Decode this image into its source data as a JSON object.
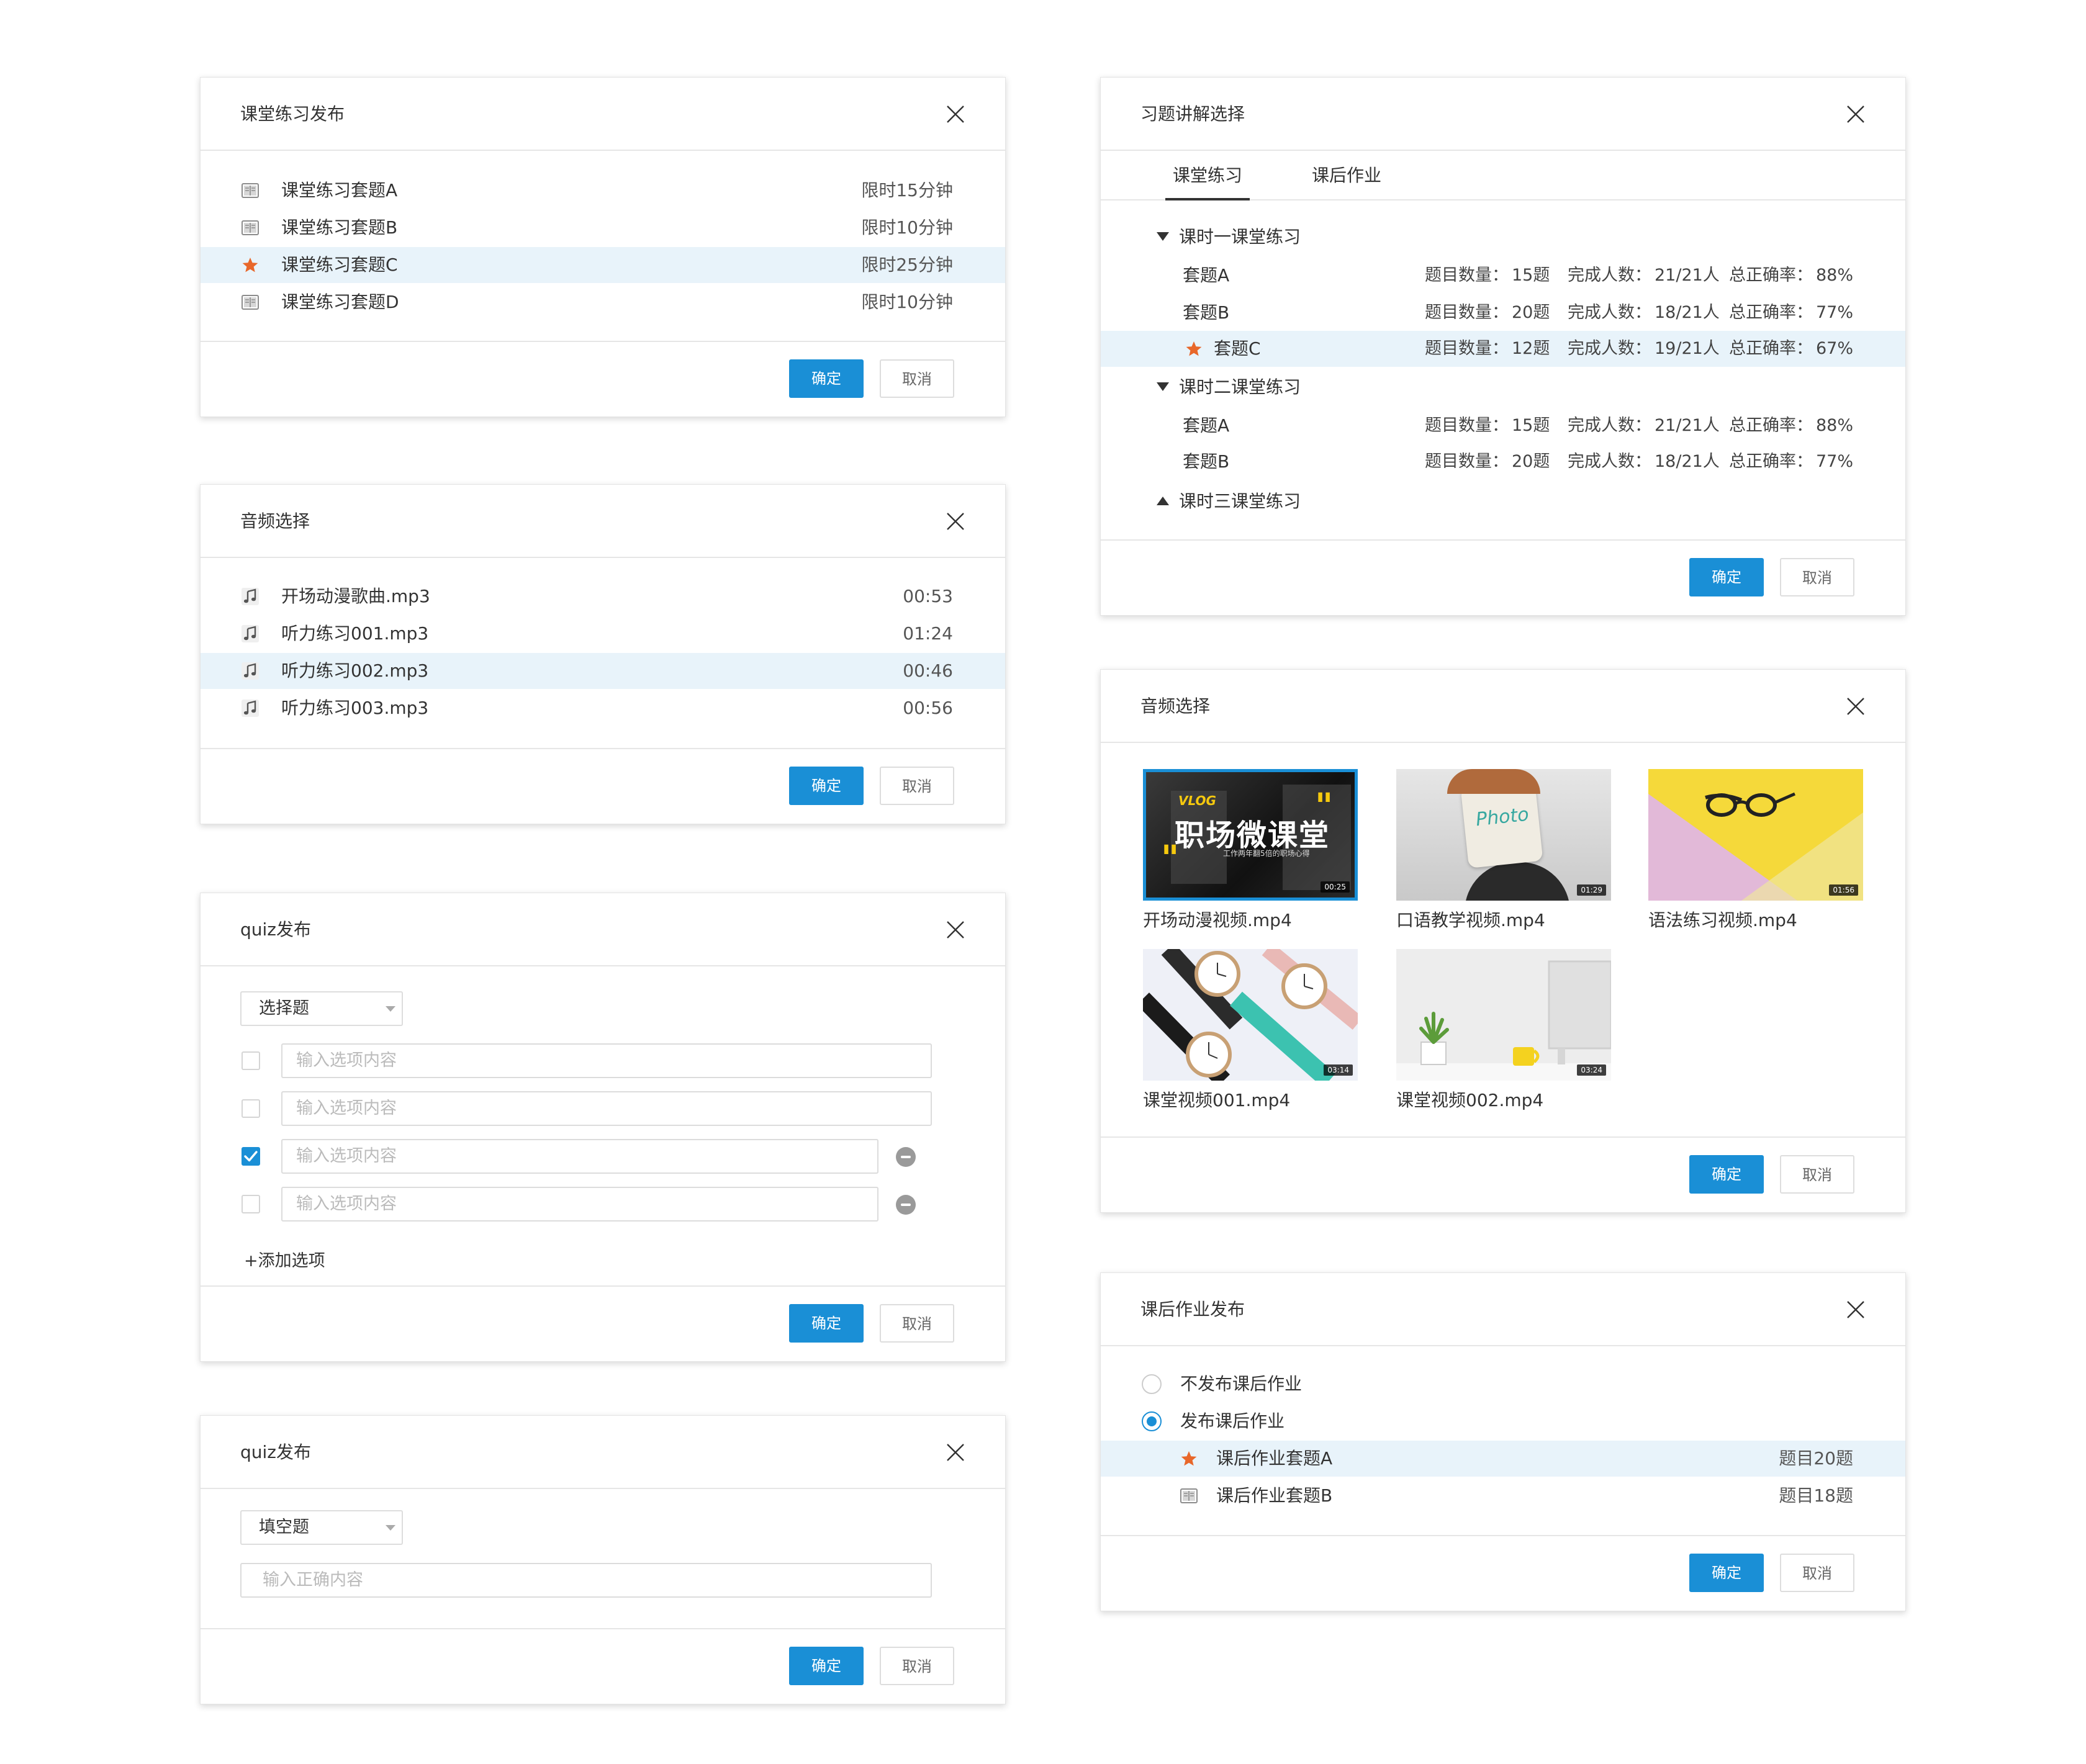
{
  "colors": {
    "accent": "#1a8fd6",
    "selected_row": "#e8f3fa",
    "star": "#e8672a"
  },
  "common": {
    "ok": "确定",
    "cancel": "取消"
  },
  "d1": {
    "title": "课堂练习发布",
    "items": [
      {
        "label": "课堂练习套题A",
        "time": "限时15分钟",
        "icon": "book-icon"
      },
      {
        "label": "课堂练习套题B",
        "time": "限时10分钟",
        "icon": "book-icon"
      },
      {
        "label": "课堂练习套题C",
        "time": "限时25分钟",
        "icon": "star-icon"
      },
      {
        "label": "课堂练习套题D",
        "time": "限时10分钟",
        "icon": "book-icon"
      }
    ]
  },
  "d2": {
    "title": "音频选择",
    "items": [
      {
        "label": "开场动漫歌曲.mp3",
        "time": "00:53",
        "icon": "music-icon"
      },
      {
        "label": "听力练习001.mp3",
        "time": "01:24",
        "icon": "music-icon"
      },
      {
        "label": "听力练习002.mp3",
        "time": "00:46",
        "icon": "music-icon"
      },
      {
        "label": "听力练习003.mp3",
        "time": "00:56",
        "icon": "music-icon"
      }
    ]
  },
  "d3": {
    "title": "quiz发布",
    "select": "选择题",
    "placeholder": "输入选项内容",
    "add": "+添加选项"
  },
  "d4": {
    "title": "quiz发布",
    "select": "填空题",
    "placeholder": "输入正确内容"
  },
  "d5": {
    "title": "习题讲解选择",
    "tabs": [
      "课堂练习",
      "课后作业"
    ],
    "stat_labels": {
      "count": "题目数量：",
      "done": "完成人数：",
      "rate": "总正确率："
    },
    "groups": [
      {
        "label": "课时一课堂练习",
        "sets": [
          {
            "label": "套题A",
            "count": "15题",
            "done": "21/21人",
            "rate": "88%"
          },
          {
            "label": "套题B",
            "count": "20题",
            "done": "18/21人",
            "rate": "77%"
          },
          {
            "label": "套题C",
            "count": "12题",
            "done": "19/21人",
            "rate": "67%"
          }
        ]
      },
      {
        "label": "课时二课堂练习",
        "sets": [
          {
            "label": "套题A",
            "count": "15题",
            "done": "21/21人",
            "rate": "88%"
          },
          {
            "label": "套题B",
            "count": "20题",
            "done": "18/21人",
            "rate": "77%"
          }
        ]
      },
      {
        "label": "课时三课堂练习",
        "sets": []
      }
    ]
  },
  "d6": {
    "title": "音频选择",
    "videos": [
      {
        "name": "开场动漫视频.mp4",
        "dur": "00:25",
        "cover_text": "职场微课堂",
        "cover_sub": "工作两年翻5倍的职场心得",
        "cover_tag": "VLOG"
      },
      {
        "name": "口语教学视频.mp4",
        "dur": "01:29",
        "cover_text": "Photo"
      },
      {
        "name": "语法练习视频.mp4",
        "dur": "01:56"
      },
      {
        "name": "课堂视频001.mp4",
        "dur": "03:14"
      },
      {
        "name": "课堂视频002.mp4",
        "dur": "03:24"
      }
    ]
  },
  "d7": {
    "title": "课后作业发布",
    "options": [
      "不发布课后作业",
      "发布课后作业"
    ],
    "items": [
      {
        "label": "课后作业套题A",
        "count": "题目20题",
        "icon": "star-icon"
      },
      {
        "label": "课后作业套题B",
        "count": "题目18题",
        "icon": "book-icon"
      }
    ]
  }
}
